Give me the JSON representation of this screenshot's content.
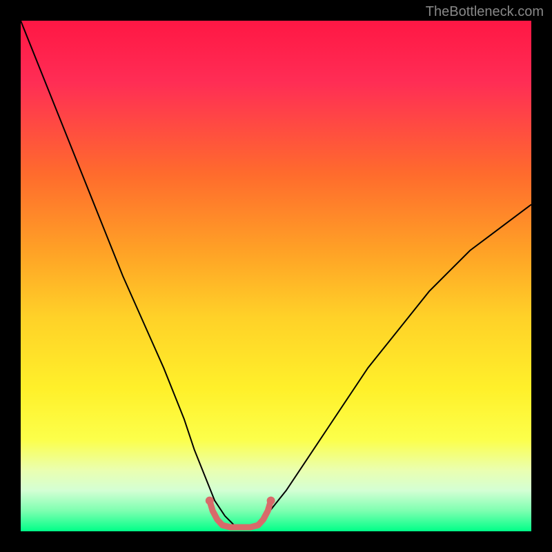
{
  "watermark": "TheBottleneck.com",
  "chart_data": {
    "type": "line",
    "title": "",
    "xlabel": "",
    "ylabel": "",
    "xlim": [
      0,
      100
    ],
    "ylim": [
      0,
      100
    ],
    "gradient_stops": [
      {
        "offset": 0.0,
        "color": "#ff1744"
      },
      {
        "offset": 0.12,
        "color": "#ff2d55"
      },
      {
        "offset": 0.3,
        "color": "#ff6b2d"
      },
      {
        "offset": 0.45,
        "color": "#ffa126"
      },
      {
        "offset": 0.58,
        "color": "#ffd128"
      },
      {
        "offset": 0.72,
        "color": "#fff02a"
      },
      {
        "offset": 0.82,
        "color": "#fcff4a"
      },
      {
        "offset": 0.88,
        "color": "#eaffb0"
      },
      {
        "offset": 0.92,
        "color": "#d4ffd4"
      },
      {
        "offset": 0.96,
        "color": "#7dffb0"
      },
      {
        "offset": 1.0,
        "color": "#00ff88"
      }
    ],
    "series": [
      {
        "name": "curve",
        "stroke": "#000000",
        "stroke_width": 2,
        "x": [
          0,
          4,
          8,
          12,
          16,
          20,
          24,
          28,
          32,
          34,
          36,
          38,
          40,
          42,
          44,
          46,
          48,
          52,
          56,
          60,
          64,
          68,
          72,
          76,
          80,
          84,
          88,
          92,
          96,
          100
        ],
        "y": [
          100,
          90,
          80,
          70,
          60,
          50,
          41,
          32,
          22,
          16,
          11,
          6,
          3,
          1,
          1,
          1,
          3,
          8,
          14,
          20,
          26,
          32,
          37,
          42,
          47,
          51,
          55,
          58,
          61,
          64
        ]
      },
      {
        "name": "optimal-marker",
        "stroke": "#d86a6a",
        "stroke_width": 9,
        "linecap": "round",
        "x": [
          37.0,
          37.6,
          38.5,
          39.5,
          41.0,
          43.0,
          45.0,
          46.5,
          47.5,
          48.4,
          49.0
        ],
        "y": [
          6.0,
          4.0,
          2.3,
          1.2,
          0.8,
          0.8,
          0.8,
          1.2,
          2.3,
          4.0,
          6.0
        ],
        "dots_x": [
          37.0,
          49.0
        ],
        "dots_y": [
          6.0,
          6.0
        ],
        "dot_radius": 6
      }
    ]
  }
}
